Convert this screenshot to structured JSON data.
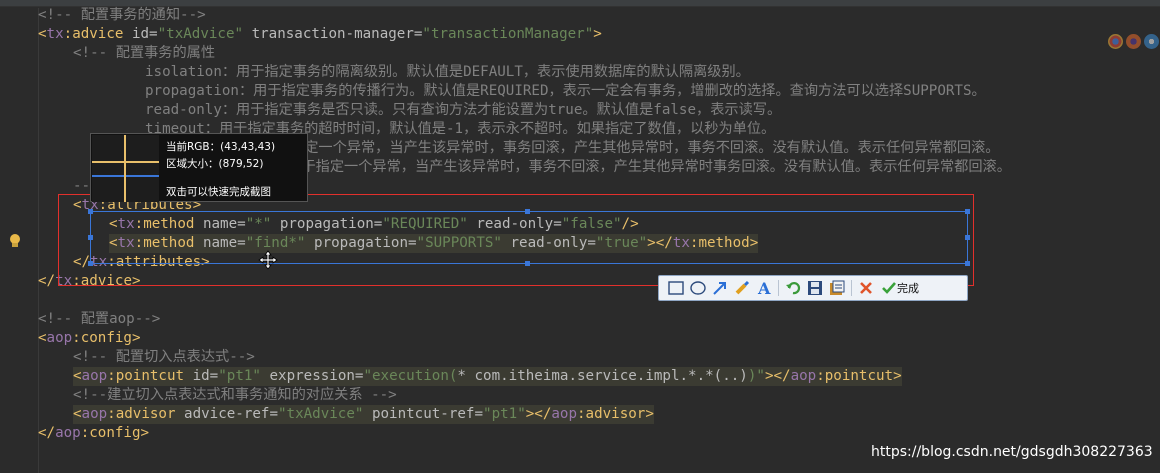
{
  "editor": {
    "lines": {
      "l1": {
        "open": "<!-- ",
        "text": "配置事务的通知",
        "close": "-->"
      },
      "l2": {
        "lt": "<",
        "prefix": "tx",
        "colon": ":",
        "tag": "advice",
        "attr1": " id=",
        "val1": "\"txAdvice\"",
        "attr2": " transaction-manager=",
        "val2": "\"transactionManager\"",
        "gt": ">"
      },
      "l3": {
        "text": "<!-- 配置事务的属性"
      },
      "l4": {
        "text": "isolation：用于指定事务的隔离级别。默认值是DEFAULT，表示使用数据库的默认隔离级别。"
      },
      "l5": {
        "text": "propagation：用于指定事务的传播行为。默认值是REQUIRED，表示一定会有事务，增删改的选择。查询方法可以选择SUPPORTS。"
      },
      "l6": {
        "text": "read-only：用于指定事务是否只读。只有查询方法才能设置为true。默认值是false，表示读写。"
      },
      "l7": {
        "text": "timeout：用于指定事务的超时时间，默认值是-1，表示永不超时。如果指定了数值，以秒为单位。"
      },
      "l8": {
        "text": "rollback-for：用于指定一个异常，当产生该异常时，事务回滚，产生其他异常时，事务不回滚。没有默认值。表示任何异常都回滚。"
      },
      "l9": {
        "text": "no-rollback-for：用于指定一个异常，当产生该异常时，事务不回滚，产生其他异常时事务回滚。没有默认值。表示任何异常都回滚。"
      },
      "l10": {
        "text": "-->"
      },
      "l11": {
        "lt": "<",
        "prefix": "tx",
        "colon": ":",
        "tag": "attributes",
        "gt": ">"
      },
      "l12": {
        "lt": "<",
        "prefix": "tx",
        "colon": ":",
        "tag": "method",
        "attr1": " name=",
        "val1": "\"*\"",
        "attr2": " propagation=",
        "val2": "\"REQUIRED\"",
        "attr3": " read-only=",
        "val3": "\"false\"",
        "gt": "/>"
      },
      "l13": {
        "lt": "<",
        "prefix": "tx",
        "colon": ":",
        "tag": "method",
        "attr1": " name=",
        "val1": "\"find*\"",
        "attr2": " propagation=",
        "val2": "\"SUPPORTS\"",
        "attr3": " read-only=",
        "val3": "\"true\"",
        "gt": "></",
        "prefix2": "tx",
        "colon2": ":",
        "tag2": "method",
        "gt2": ">"
      },
      "l14": {
        "lt": "</",
        "prefix": "tx",
        "colon": ":",
        "tag": "attributes",
        "gt": ">"
      },
      "l15": {
        "lt": "</",
        "prefix": "tx",
        "colon": ":",
        "tag": "advice",
        "gt": ">"
      },
      "l17": {
        "text": "<!-- 配置aop-->"
      },
      "l18": {
        "lt": "<",
        "prefix": "aop",
        "colon": ":",
        "tag": "config",
        "gt": ">"
      },
      "l19": {
        "text": "<!-- 配置切入点表达式-->"
      },
      "l20": {
        "lt": "<",
        "prefix": "aop",
        "colon": ":",
        "tag": "pointcut",
        "attr1": " id=",
        "val1": "\"pt1\"",
        "attr2": " expression=",
        "val2": "\"execution(",
        "plain": "* com.itheima.service.impl.*.*(..)",
        "val3": ")\"",
        "gt": "></",
        "prefix2": "aop",
        "colon2": ":",
        "tag2": "pointcut",
        "gt2": ">"
      },
      "l21": {
        "text": "<!--建立切入点表达式和事务通知的对应关系 -->"
      },
      "l22": {
        "lt": "<",
        "prefix": "aop",
        "colon": ":",
        "tag": "advisor",
        "attr1": " advice-ref=",
        "val1": "\"txAdvice\"",
        "attr2": " pointcut-ref=",
        "val2": "\"pt1\"",
        "gt": "></",
        "prefix2": "aop",
        "colon2": ":",
        "tag2": "advisor",
        "gt2": ">"
      },
      "l23": {
        "lt": "</",
        "prefix": "aop",
        "colon": ":",
        "tag": "config",
        "gt": ">"
      }
    }
  },
  "magnifier": {
    "rgb_label": "当前RGB：(43,43,43)",
    "size_label": "区域大小：(879,52)",
    "hint": "双击可以快速完成截图"
  },
  "toolbar": {
    "done_label": "完成",
    "tools": [
      "rectangle-tool",
      "ellipse-tool",
      "arrow-tool",
      "brush-tool",
      "text-tool",
      "undo-tool",
      "save-tool",
      "copy-tool",
      "cancel-tool",
      "confirm-tool"
    ]
  },
  "watermark": "https://blog.csdn.net/gdsgdh308227363",
  "colors": {
    "background": "#2b2b2b",
    "tag": "#e8bf6a",
    "attribute": "#bababa",
    "value": "#6a8759",
    "comment": "#808080",
    "namespace": "#9876aa",
    "selection_red": "#e2302c",
    "selection_blue": "#3a76d8"
  }
}
